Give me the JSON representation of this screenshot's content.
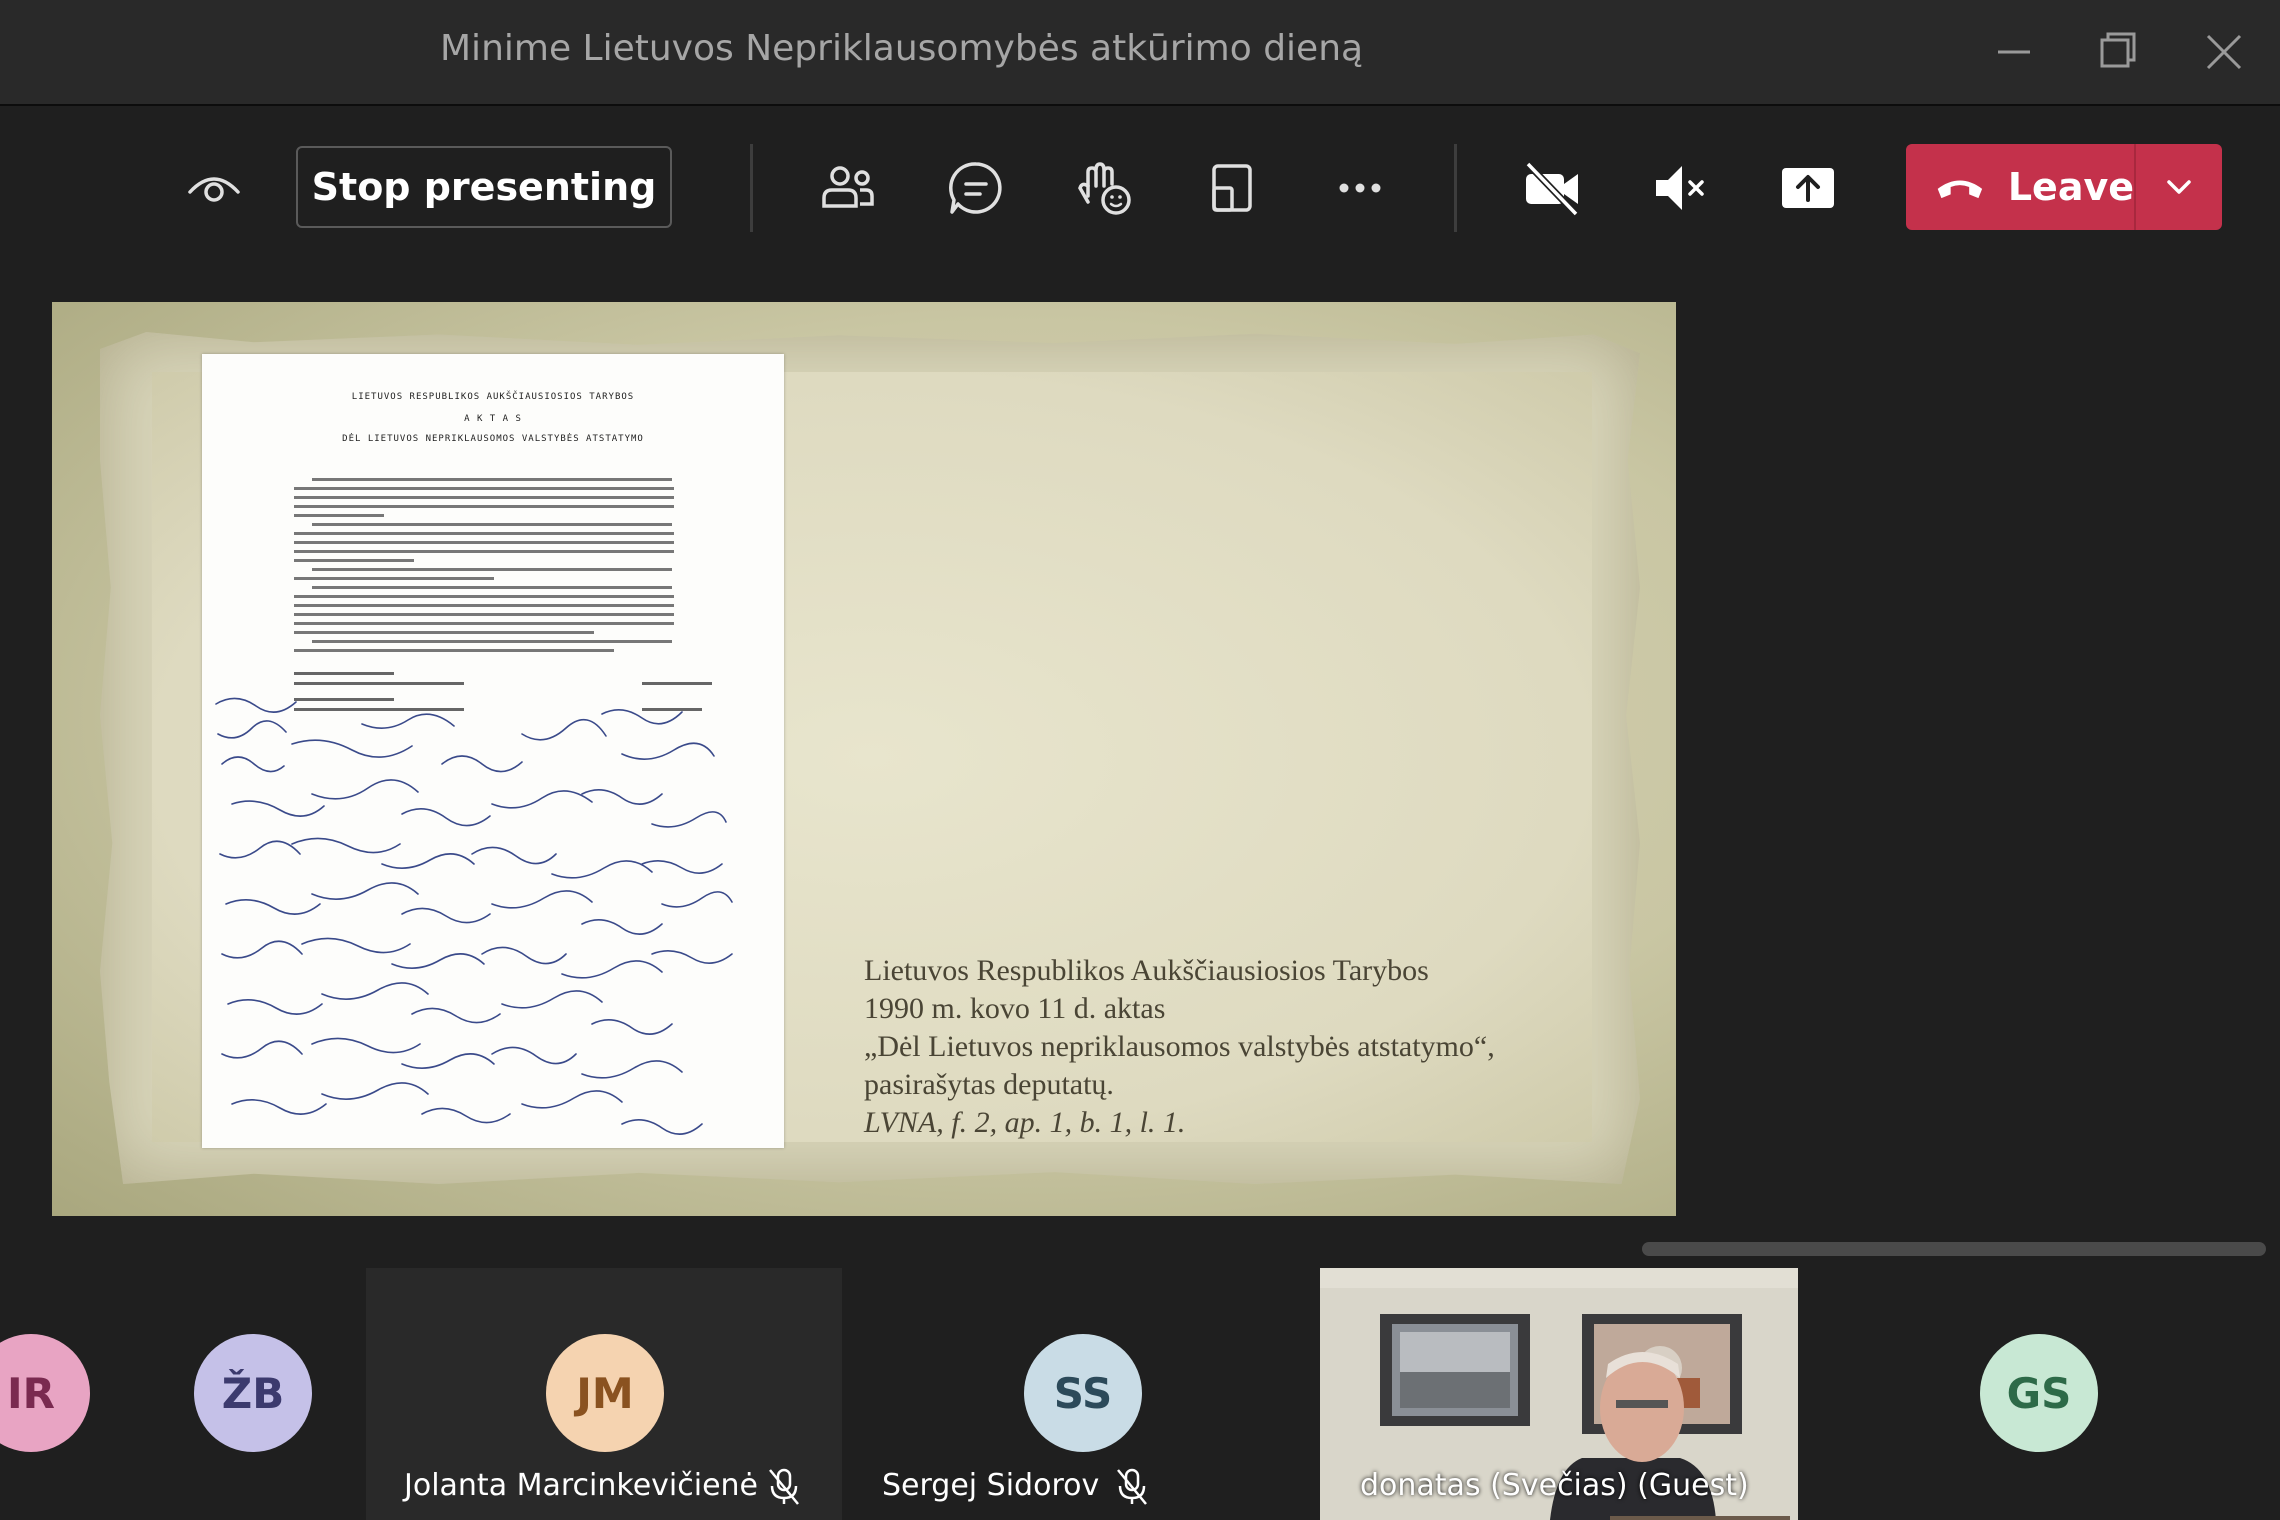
{
  "window": {
    "title": "Minime Lietuvos Nepriklausomybės atkūrimo dieną"
  },
  "toolbar": {
    "stop_presenting_label": "Stop presenting",
    "leave_label": "Leave"
  },
  "slide": {
    "document_heading_1": "LIETUVOS RESPUBLIKOS AUKŠČIAUSIOSIOS TARYBOS",
    "document_heading_2": "A K T A S",
    "document_heading_3": "DĖL LIETUVOS NEPRIKLAUSOMOS VALSTYBĖS ATSTATYMO",
    "caption_lines": [
      "Lietuvos Respublikos Aukščiausiosios Tarybos",
      "1990 m. kovo 11 d. aktas",
      "„Dėl Lietuvos nepriklausomos valstybės atstatymo“,",
      "pasirašytas deputatų."
    ],
    "caption_citation": "LVNA, f. 2, ap. 1, b. 1, l. 1."
  },
  "participants": [
    {
      "initials": "IR",
      "color": "#e8a4c3",
      "text_color": "#7a2a50"
    },
    {
      "initials": "ŽB",
      "color": "#c5c1e8",
      "text_color": "#3c3a6e"
    },
    {
      "initials": "JM",
      "color": "#f5d3b0",
      "text_color": "#8a5220",
      "name": "Jolanta Marcinkevičienė",
      "muted": true
    },
    {
      "initials": "SS",
      "color": "#c9dce6",
      "text_color": "#2c4a5a",
      "name": "Sergej Sidorov",
      "muted": true
    },
    {
      "name": "donatas (Svečias) (Guest)",
      "video": true
    },
    {
      "initials": "GS",
      "color": "#c8e8d4",
      "text_color": "#2d6a48"
    }
  ],
  "colors": {
    "leave": "#c4314b",
    "background": "#1f1f1f",
    "titlebar": "#292929"
  }
}
